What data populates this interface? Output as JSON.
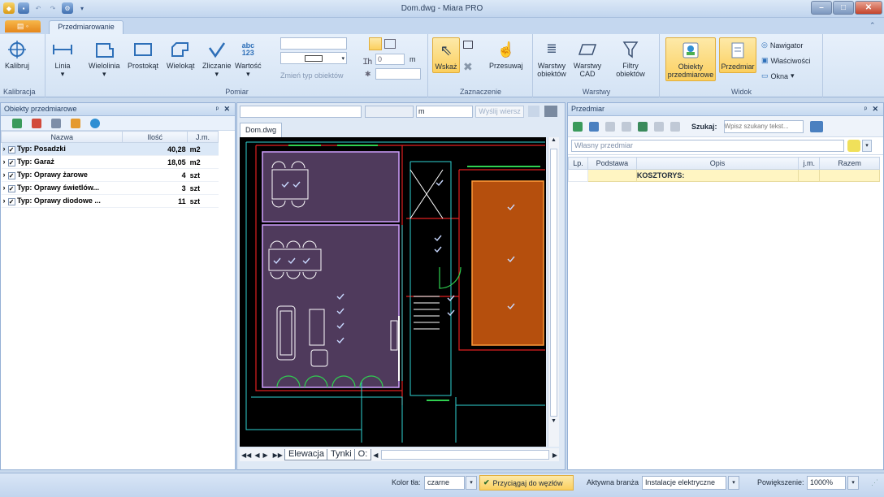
{
  "window": {
    "title": "Dom.dwg - Miara PRO"
  },
  "ribbon": {
    "tab": "Przedmiarowanie",
    "groups": {
      "kalibracja": {
        "label": "Kalibracja",
        "kalibruj": "Kalibruj"
      },
      "pomiar": {
        "label": "Pomiar",
        "linia": "Linia",
        "wielolinia": "Wielolinia",
        "prostokat": "Prostokąt",
        "wielokat": "Wielokąt",
        "zliczanie": "Zliczanie",
        "wartosc": "Wartość",
        "wartosc_icon_text": "abc\n123",
        "zmien_typ": "Zmień typ obiektów",
        "height_value": "0",
        "height_unit": "m"
      },
      "zaznaczenie": {
        "label": "Zaznaczenie",
        "wskaz": "Wskaż",
        "przesuwaj": "Przesuwaj"
      },
      "warstwy": {
        "label": "Warstwy",
        "warstwy_obiektow": "Warstwy obiektów",
        "warstwy_cad": "Warstwy CAD",
        "filtry": "Filtry obiektów"
      },
      "widok": {
        "label": "Widok",
        "obiekty": "Obiekty przedmiarowe",
        "przedmiar": "Przedmiar",
        "nawigator": "Nawigator",
        "wlasciwosci": "Właściwości",
        "okna": "Okna"
      }
    }
  },
  "left_panel": {
    "title": "Obiekty przedmiarowe",
    "columns": [
      "Nazwa",
      "Ilość",
      "J.m."
    ],
    "rows": [
      {
        "name": "Typ: Posadzki",
        "qty": "40,28",
        "unit": "m2"
      },
      {
        "name": "Typ: Garaż",
        "qty": "18,05",
        "unit": "m2"
      },
      {
        "name": "Typ: Oprawy żarowe",
        "qty": "4",
        "unit": "szt"
      },
      {
        "name": "Typ: Oprawy świetlów...",
        "qty": "3",
        "unit": "szt"
      },
      {
        "name": "Typ: Oprawy diodowe ...",
        "qty": "11",
        "unit": "szt"
      }
    ]
  },
  "center": {
    "cmd_unit": "m",
    "send_line": "Wyślij wiersz",
    "doc_tab": "Dom.dwg",
    "sheet_tabs": [
      "Elewacja",
      "Tynki",
      "O:"
    ]
  },
  "right_panel": {
    "title": "Przedmiar",
    "search_label": "Szukaj:",
    "search_placeholder": "Wpisz szukany tekst...",
    "przedmiar_select": "Własny przedmiar",
    "columns": [
      "Lp.",
      "Podstawa",
      "Opis",
      "j.m.",
      "Razem"
    ],
    "row_opis": "KOSZTORYS:"
  },
  "status": {
    "kolor_label": "Kolor tła:",
    "kolor_value": "czarne",
    "przyciagaj": "Przyciągaj do węzłów",
    "branza_label": "Aktywna branża",
    "branza_value": "Instalacje elektryczne",
    "zoom_label": "Powiększenie:",
    "zoom_value": "1000%"
  },
  "colors": {
    "accent": "#fbcf5e",
    "cad_bg": "#000000",
    "room_fill": "#5a3d68",
    "orange_room": "#c85a10"
  }
}
